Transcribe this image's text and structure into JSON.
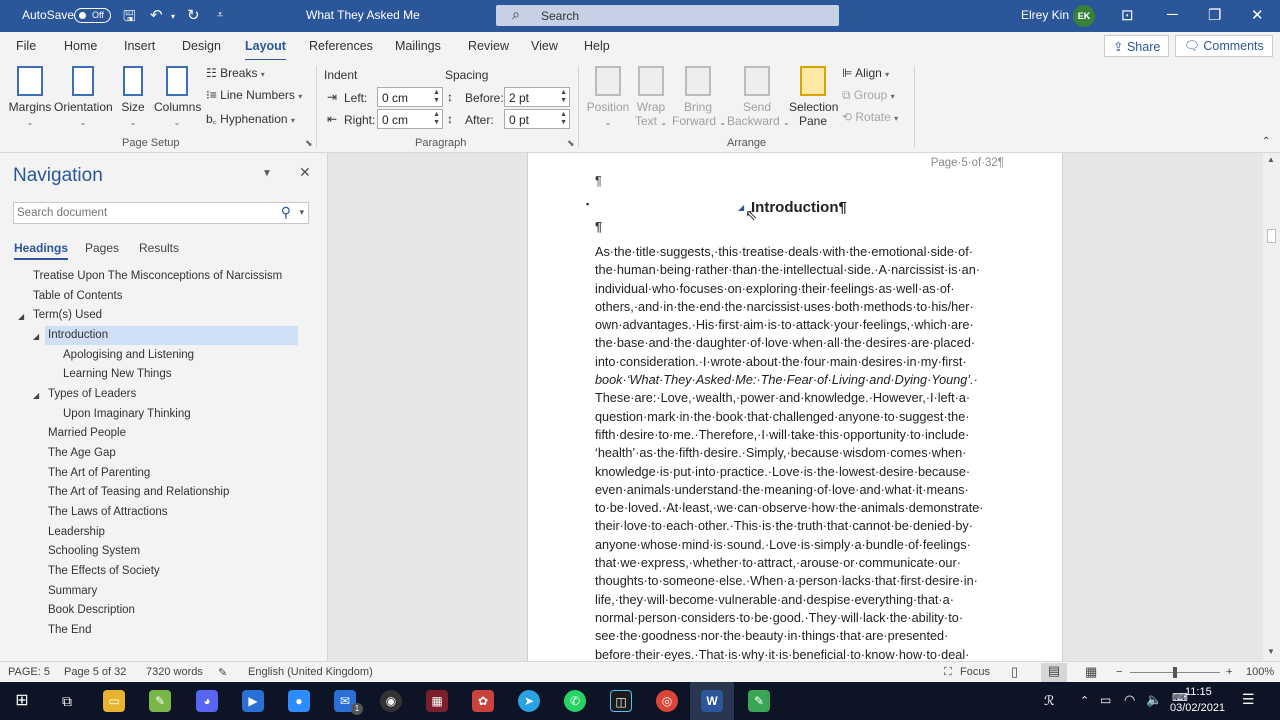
{
  "titlebar": {
    "autosave": "AutoSave",
    "autosave_state": "Off",
    "doc_title": "What They Asked Me",
    "search": "Search",
    "user": "Elrey Kin",
    "initials": "EK"
  },
  "tabs": [
    "File",
    "Home",
    "Insert",
    "Design",
    "Layout",
    "References",
    "Mailings",
    "Review",
    "View",
    "Help"
  ],
  "share": "Share",
  "comments": "Comments",
  "ribbon": {
    "margins": "Margins",
    "orientation": "Orientation",
    "size": "Size",
    "columns": "Columns",
    "breaks": "Breaks",
    "line_numbers": "Line Numbers",
    "hyphenation": "Hyphenation",
    "page_setup": "Page Setup",
    "indent": "Indent",
    "spacing": "Spacing",
    "left": "Left:",
    "right": "Right:",
    "before": "Before:",
    "after": "After:",
    "left_val": "0 cm",
    "right_val": "0 cm",
    "before_val": "2 pt",
    "after_val": "0 pt",
    "paragraph": "Paragraph",
    "position": "Position",
    "wrap1": "Wrap",
    "wrap2": "Text",
    "bring1": "Bring",
    "bring2": "Forward",
    "send1": "Send",
    "send2": "Backward",
    "selection1": "Selection",
    "selection2": "Pane",
    "align": "Align",
    "group": "Group",
    "rotate": "Rotate",
    "arrange": "Arrange"
  },
  "nav": {
    "title": "Navigation",
    "search_placeholder": "Search document",
    "tabs": [
      "Headings",
      "Pages",
      "Results"
    ],
    "headings": [
      "Treatise Upon The Misconceptions of Narcissism",
      "Table of Contents",
      "Term(s) Used",
      "Introduction",
      "Apologising and Listening",
      "Learning New Things",
      "Types of Leaders",
      "Upon Imaginary Thinking",
      "Married People",
      "The Age Gap",
      "The Art of Parenting",
      "The Art of Teasing and Relationship",
      "The Laws of Attractions",
      "Leadership",
      "Schooling System",
      "The Effects of Society",
      "Summary",
      "Book Description",
      "The End"
    ]
  },
  "document": {
    "page_label": "Page·5·of·32¶",
    "pilcrow": "¶",
    "heading": "Introduction¶",
    "lines": [
      "As·the·title·suggests,·this·treatise·deals·with·the·emotional·side·of·",
      "the·human·being·rather·than·the·intellectual·side.·A·narcissist·is·an·",
      "individual·who·focuses·on·exploring·their·feelings·as·well·as·of·",
      "others,·and·in·the·end·the·narcissist·uses·both·methods·to·his/her·",
      "own·advantages.·His·first·aim·is·to·attack·your·feelings,·which·are·",
      "the·base·and·the·daughter·of·love·when·all·the·desires·are·placed·",
      "into·consideration.·I·wrote·about·the·four·main·desires·in·my·first·",
      "book·‘What·They·Asked·Me:·The·Fear·of·Living·and·Dying·Young’.·",
      "These·are:·Love,·wealth,·power·and·knowledge.·However,·I·left·a·",
      "question·mark·in·the·book·that·challenged·anyone·to·suggest·the·",
      "fifth·desire·to·me.·Therefore,·I·will·take·this·opportunity·to·include·",
      "‘health’·as·the·fifth·desire.·Simply,·because·wisdom·comes·when·",
      "knowledge·is·put·into·practice.·Love·is·the·lowest·desire·because·",
      "even·animals·understand·the·meaning·of·love·and·what·it·means·",
      "to·be·loved.·At·least,·we·can·observe·how·the·animals·demonstrate·",
      "their·love·to·each·other.·This·is·the·truth·that·cannot·be·denied·by·",
      "anyone·whose·mind·is·sound.·Love·is·simply·a·bundle·of·feelings·",
      "that·we·express,·whether·to·attract,·arouse·or·communicate·our·",
      "thoughts·to·someone·else.·When·a·person·lacks·that·first·desire·in·",
      "life,·they·will·become·vulnerable·and·despise·everything·that·a·",
      "normal·person·considers·to·be·good.·They·will·lack·the·ability·to·",
      "see·the·goodness·nor·the·beauty·in·things·that·are·presented·",
      "before·their·eyes.·That·is·why·it·is·beneficial·to·know·how·to·deal·"
    ]
  },
  "status": {
    "page": "PAGE: 5",
    "page_of": "Page 5 of 32",
    "words": "7320 words",
    "language": "English (United Kingdom)",
    "focus": "Focus",
    "zoom": "100%"
  },
  "taskbar": {
    "time": "11:15",
    "date": "03/02/2021",
    "mail_badge": "1"
  },
  "colors": {
    "word_blue": "#2b579a",
    "taskbar": "#0c1426"
  }
}
